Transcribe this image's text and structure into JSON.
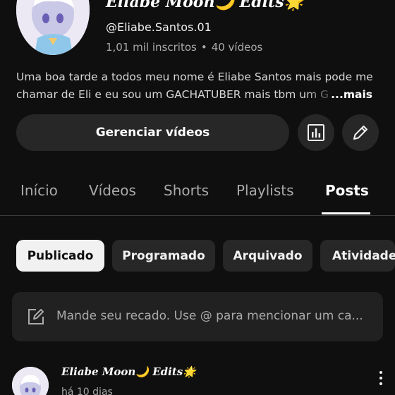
{
  "channel": {
    "name": "Eliabe Moon🌙 Edits🌟",
    "handle": "@Eliabe.Santos.01",
    "subscribers": "1,01 mil inscritos",
    "separator": "•",
    "videos": "40 vídeos",
    "description_line1": "Uma boa tarde a todos meu nome é Eliabe Santos mais pode me",
    "description_line2": "chamar de Eli e eu sou um GACHATUBER mais tbm um GA",
    "more_label": "...mais"
  },
  "actions": {
    "manage_label": "Gerenciar vídeos",
    "analytics_icon": "analytics-icon",
    "edit_icon": "pencil-icon"
  },
  "tabs": [
    {
      "label": "Início",
      "active": false
    },
    {
      "label": "Vídeos",
      "active": false
    },
    {
      "label": "Shorts",
      "active": false
    },
    {
      "label": "Playlists",
      "active": false
    },
    {
      "label": "Posts",
      "active": true
    }
  ],
  "chips": [
    {
      "label": "Publicado",
      "active": true
    },
    {
      "label": "Programado",
      "active": false
    },
    {
      "label": "Arquivado",
      "active": false
    },
    {
      "label": "Atividade",
      "active": false
    }
  ],
  "composer": {
    "placeholder": "Mande seu recado. Use @ para mencionar um ca...",
    "icon": "edit-post-icon"
  },
  "post": {
    "author": "Eliabe Moon🌙 Edits🌟",
    "time": "há 10 dias"
  },
  "colors": {
    "background": "#0f0f0f",
    "surface": "#272727",
    "active_chip": "#f1f1f1",
    "secondary_text": "#aaaaaa"
  }
}
